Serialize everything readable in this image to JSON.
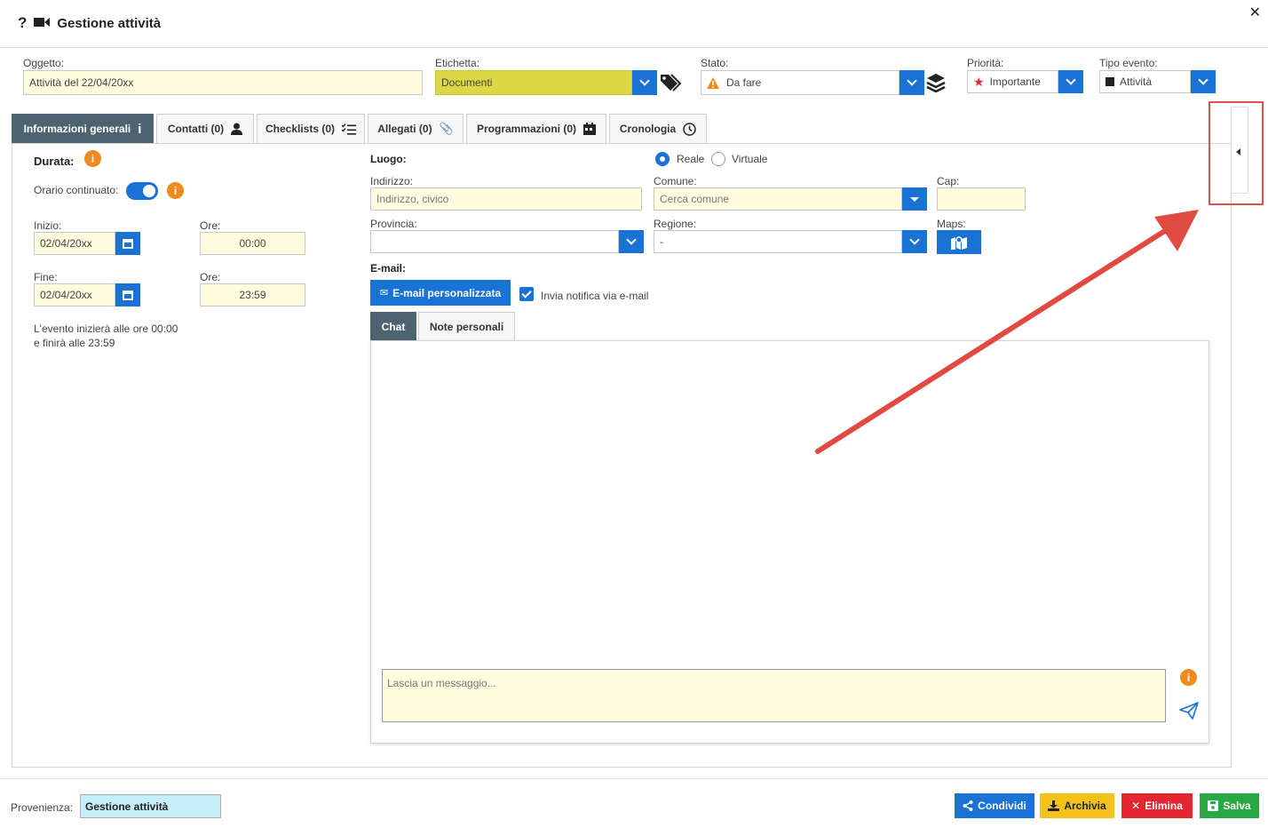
{
  "header": {
    "title": "Gestione attività"
  },
  "form": {
    "oggetto": {
      "label": "Oggetto:",
      "value": "Attività del 22/04/20xx"
    },
    "etichetta": {
      "label": "Etichetta:",
      "value": "Documenti"
    },
    "stato": {
      "label": "Stato:",
      "value": "Da fare"
    },
    "priorita": {
      "label": "Priorità:",
      "value": "Importante"
    },
    "tipo_evento": {
      "label": "Tipo evento:",
      "value": "Attività"
    }
  },
  "tabs": [
    {
      "label": "Informazioni generali"
    },
    {
      "label": "Contatti (0)"
    },
    {
      "label": "Checklists (0)"
    },
    {
      "label": "Allegati (0)"
    },
    {
      "label": "Programmazioni (0)"
    },
    {
      "label": "Cronologia"
    }
  ],
  "durata": {
    "title": "Durata:",
    "continuato_label": "Orario continuato:",
    "inizio_label": "Inizio:",
    "inizio_value": "02/04/20xx",
    "ore_label": "Ore:",
    "inizio_ore": "00:00",
    "fine_label": "Fine:",
    "fine_value": "02/04/20xx",
    "fine_ore": "23:59",
    "note_line1": "L'evento inizierà alle ore 00:00",
    "note_line2": "e finirà alle 23:59"
  },
  "luogo": {
    "title": "Luogo:",
    "reale": "Reale",
    "virtuale": "Virtuale",
    "indirizzo_label": "Indirizzo:",
    "indirizzo_placeholder": "Indirizzo, civico",
    "comune_label": "Comune:",
    "comune_placeholder": "Cerca comune",
    "cap_label": "Cap:",
    "provincia_label": "Provincia:",
    "regione_label": "Regione:",
    "regione_value": "-",
    "maps_label": "Maps:"
  },
  "email": {
    "title": "E-mail:",
    "button": "E-mail personalizzata",
    "notify_label": "Invia notifica via e-mail"
  },
  "subtabs": [
    {
      "label": "Chat"
    },
    {
      "label": "Note personali"
    }
  ],
  "chat": {
    "placeholder": "Lascia un messaggio..."
  },
  "footer": {
    "provenienza_label": "Provenienza:",
    "provenienza_value": "Gestione attività",
    "buttons": {
      "condividi": "Condividi",
      "archivia": "Archivia",
      "elimina": "Elimina",
      "salva": "Salva"
    }
  },
  "colors": {
    "accent": "#1a73d4",
    "active_tab": "#4d6470",
    "etichetta": "#dcd843",
    "archivia": "#f2c21b",
    "elimina": "#e52632",
    "salva": "#28a745",
    "annotation": "#d9534f"
  }
}
